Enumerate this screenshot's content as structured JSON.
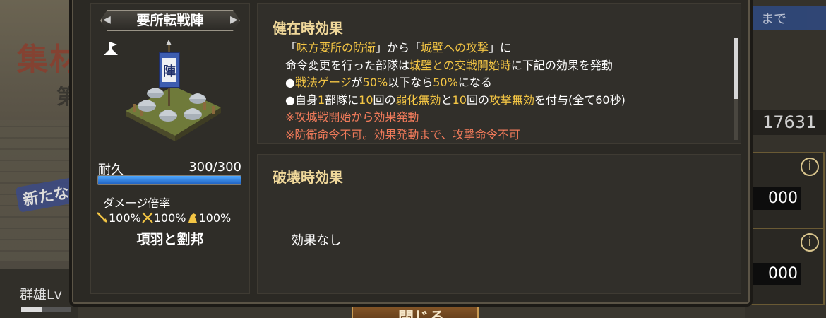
{
  "background": {
    "event_title": "集材",
    "event_sub": "第",
    "badge": "新たな",
    "gunyu_label": "群雄Lv",
    "banner_text": "まで",
    "resource_number": "17631",
    "cards": [
      {
        "value": "000"
      },
      {
        "value": "000"
      }
    ],
    "bottom_button": "閉じる"
  },
  "fort": {
    "name": "要所転戦陣",
    "durability_label": "耐久",
    "durability_value": "300/300",
    "durability_fraction": 1.0,
    "damage_label": "ダメージ倍率",
    "damage_multipliers": [
      {
        "icon": "spear-icon",
        "value": "100%"
      },
      {
        "icon": "crossed-swords-icon",
        "value": "100%"
      },
      {
        "icon": "horse-icon",
        "value": "100%"
      }
    ],
    "owner": "項羽と劉邦"
  },
  "alive_effect": {
    "title": "健在時効果",
    "lines": [
      [
        {
          "t": "「",
          "c": "w"
        },
        {
          "t": "味方要所の防衛",
          "c": "y"
        },
        {
          "t": "」から「",
          "c": "w"
        },
        {
          "t": "城壁への攻撃",
          "c": "y"
        },
        {
          "t": "」に",
          "c": "w"
        }
      ],
      [
        {
          "t": "命令変更を行った部隊は",
          "c": "w"
        },
        {
          "t": "城壁との交戦開始時",
          "c": "y"
        },
        {
          "t": "に下記の効果を発動",
          "c": "w"
        }
      ],
      [
        {
          "t": "●",
          "c": "w"
        },
        {
          "t": "戦法ゲージ",
          "c": "y"
        },
        {
          "t": "が",
          "c": "w"
        },
        {
          "t": "50%",
          "c": "y"
        },
        {
          "t": "以下なら",
          "c": "w"
        },
        {
          "t": "50%",
          "c": "y"
        },
        {
          "t": "になる",
          "c": "w"
        }
      ],
      [
        {
          "t": "●自身",
          "c": "w"
        },
        {
          "t": "1",
          "c": "y"
        },
        {
          "t": "部隊に",
          "c": "w"
        },
        {
          "t": "10",
          "c": "y"
        },
        {
          "t": "回の",
          "c": "w"
        },
        {
          "t": "弱化無効",
          "c": "y"
        },
        {
          "t": "と",
          "c": "w"
        },
        {
          "t": "10",
          "c": "y"
        },
        {
          "t": "回の",
          "c": "w"
        },
        {
          "t": "攻撃無効",
          "c": "y"
        },
        {
          "t": "を付与(全て60秒)",
          "c": "w"
        }
      ],
      [
        {
          "t": "※攻城戦開始から効果発動",
          "c": "r"
        }
      ],
      [
        {
          "t": "※防衛命令不可。効果発動まで、攻撃命令不可",
          "c": "r"
        }
      ]
    ],
    "scroll_fraction": 0.6
  },
  "destroy_effect": {
    "title": "破壊時効果",
    "text": "効果なし"
  },
  "colors": {
    "highlight": "#f3c544",
    "warning": "#f07a5a",
    "section_title": "#f0d89a",
    "durability_bar": "#2f7fe0"
  }
}
